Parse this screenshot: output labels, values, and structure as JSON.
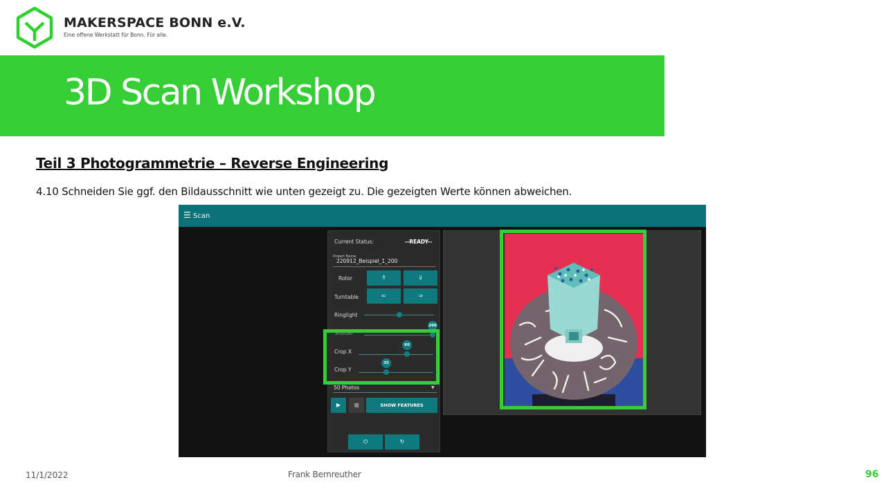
{
  "header": {
    "org_name": "MAKERSPACE BONN e.V.",
    "tagline": "Eine offene Werkstatt für Bonn. Für alle.",
    "brand_color": "#36cd36"
  },
  "title": "3D Scan Workshop",
  "section_heading": "Teil 3  Photogrammetrie  – Reverse Engineering",
  "instruction": "4.10 Schneiden Sie ggf. den Bildausschnitt wie unten gezeigt zu. Die gezeigten Werte können abweichen.",
  "app": {
    "menu_icon": "☰",
    "title": "Scan",
    "accent_color": "#0b7377",
    "status_label": "Current Status:",
    "status_value": "--READY--",
    "project_label": "Project Name",
    "project_value": "220912_Beispiel_1_200",
    "rotor_label": "Rotor",
    "rotor_up": "⇑",
    "rotor_down": "⇓",
    "turntable_label": "Turntable",
    "turntable_left": "⇐",
    "turntable_right": "⇒",
    "ringlight_label": "Ringlight",
    "ringlight_level": 0.5,
    "shutter_label": "Shutter",
    "shutter_value": "200",
    "crop_x_label": "Crop X",
    "crop_x_value": "60",
    "crop_y_label": "Crop Y",
    "crop_y_value": "35",
    "photos_select": "50 Photos",
    "play_icon": "▶",
    "stop_icon": "■",
    "show_features": "SHOW FEATURES",
    "power_icon": "⏻",
    "refresh_icon": "↻"
  },
  "footer": {
    "date": "11/1/2022",
    "author": "Frank Bernreuther",
    "page": "96"
  }
}
